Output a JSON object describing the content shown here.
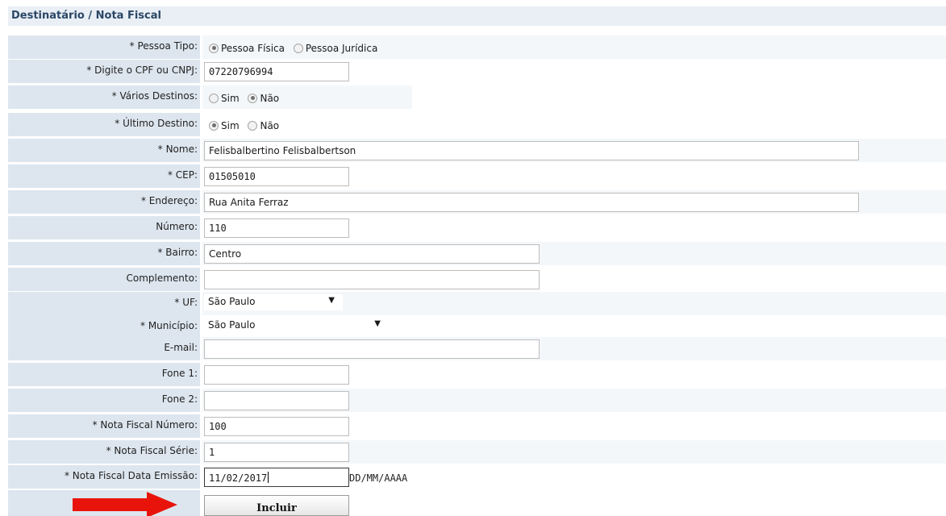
{
  "section_title": "Destinatário / Nota Fiscal",
  "fields": {
    "pessoa_tipo": {
      "label": "* Pessoa Tipo:",
      "options": [
        "Pessoa Física",
        "Pessoa Jurídica"
      ],
      "selected": "Pessoa Física"
    },
    "cpf_cnpj": {
      "label": "* Digite o CPF ou CNPJ:",
      "value": "07220796994"
    },
    "varios_destinos": {
      "label": "* Vários Destinos:",
      "options": [
        "Sim",
        "Não"
      ],
      "selected": "Não"
    },
    "ultimo_destino": {
      "label": "* Último Destino:",
      "options": [
        "Sim",
        "Não"
      ],
      "selected": "Sim"
    },
    "nome": {
      "label": "* Nome:",
      "value": "Felisbalbertino Felisbalbertson"
    },
    "cep": {
      "label": "* CEP:",
      "value": "01505010"
    },
    "endereco": {
      "label": "* Endereço:",
      "value": "Rua Anita Ferraz"
    },
    "numero": {
      "label": "Número:",
      "value": "110"
    },
    "bairro": {
      "label": "* Bairro:",
      "value": "Centro"
    },
    "complemento": {
      "label": "Complemento:",
      "value": ""
    },
    "uf": {
      "label": "* UF:",
      "value": "São Paulo"
    },
    "municipio": {
      "label": "* Município:",
      "value": "São Paulo"
    },
    "email": {
      "label": "E-mail:",
      "value": ""
    },
    "fone1": {
      "label": "Fone 1:",
      "value": ""
    },
    "fone2": {
      "label": "Fone 2:",
      "value": ""
    },
    "nf_numero": {
      "label": "* Nota Fiscal Número:",
      "value": "100"
    },
    "nf_serie": {
      "label": "* Nota Fiscal Série:",
      "value": "1"
    },
    "nf_data": {
      "label": "* Nota Fiscal Data Emissão:",
      "value": "11/02/2017",
      "hint": "DD/MM/AAAA"
    }
  },
  "submit_label": "Incluir",
  "arrow_icon": "right-arrow-icon",
  "colors": {
    "label_bg": "#dde6ef",
    "header_text": "#2b4766",
    "arrow": "#e8140c"
  }
}
